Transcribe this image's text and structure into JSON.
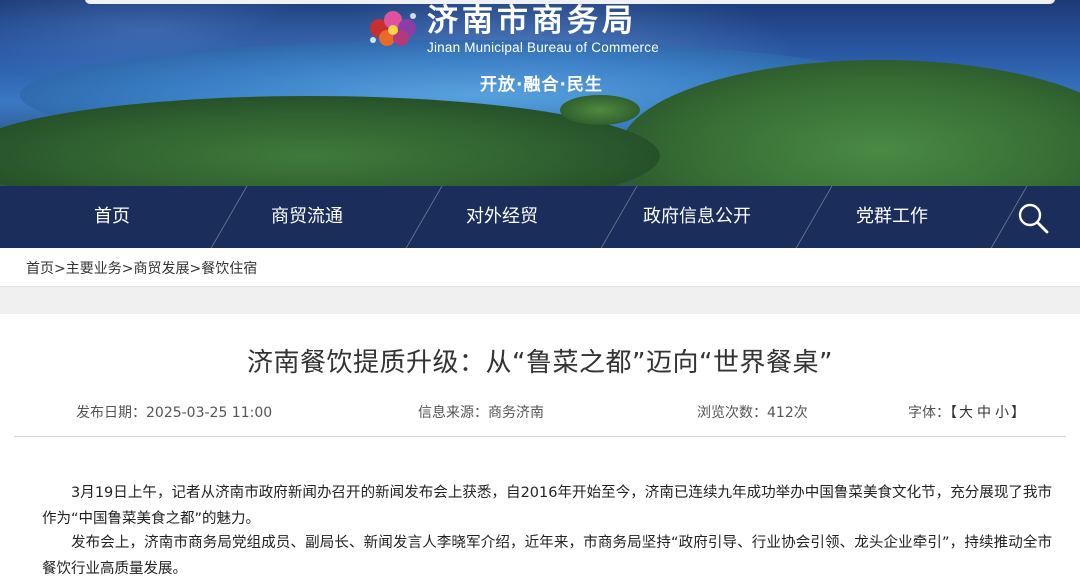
{
  "header": {
    "title_cn": "济南市商务局",
    "title_en": "Jinan Municipal Bureau of Commerce",
    "slogan": "开放·融合·民生",
    "logo_icon": "logo-flower-icon"
  },
  "nav": {
    "items": [
      {
        "label": "首页"
      },
      {
        "label": "商贸流通"
      },
      {
        "label": "对外经贸"
      },
      {
        "label": "政府信息公开"
      },
      {
        "label": "党群工作"
      }
    ],
    "search_icon": "search-icon",
    "bg_color": "#1b2d5a"
  },
  "breadcrumb": {
    "items": [
      "首页",
      "主要业务",
      "商贸发展",
      "餐饮住宿"
    ],
    "separator": ">"
  },
  "article": {
    "title": "济南餐饮提质升级：从“鲁菜之都”迈向“世界餐桌”",
    "meta": {
      "date_label": "发布日期：",
      "date_value": "2025-03-25 11:00",
      "source_label": "信息来源：",
      "source_value": "商务济南",
      "views_label": "浏览次数：",
      "views_value": "412次",
      "font_label": "字体：",
      "font_open": "【",
      "font_large": "大",
      "font_medium": "中",
      "font_small": "小",
      "font_close": "】"
    },
    "paragraphs": [
      "3月19日上午，记者从济南市政府新闻办召开的新闻发布会上获悉，自2016年开始至今，济南已连续九年成功举办中国鲁菜美食文化节，充分展现了我市作为“中国鲁菜美食之都”的魅力。",
      "发布会上，济南市商务局党组成员、副局长、新闻发言人李晓军介绍，近年来，市商务局坚持“政府引导、行业协会引领、龙头企业牵引”，持续推动全市餐饮行业高质量发展。"
    ]
  }
}
